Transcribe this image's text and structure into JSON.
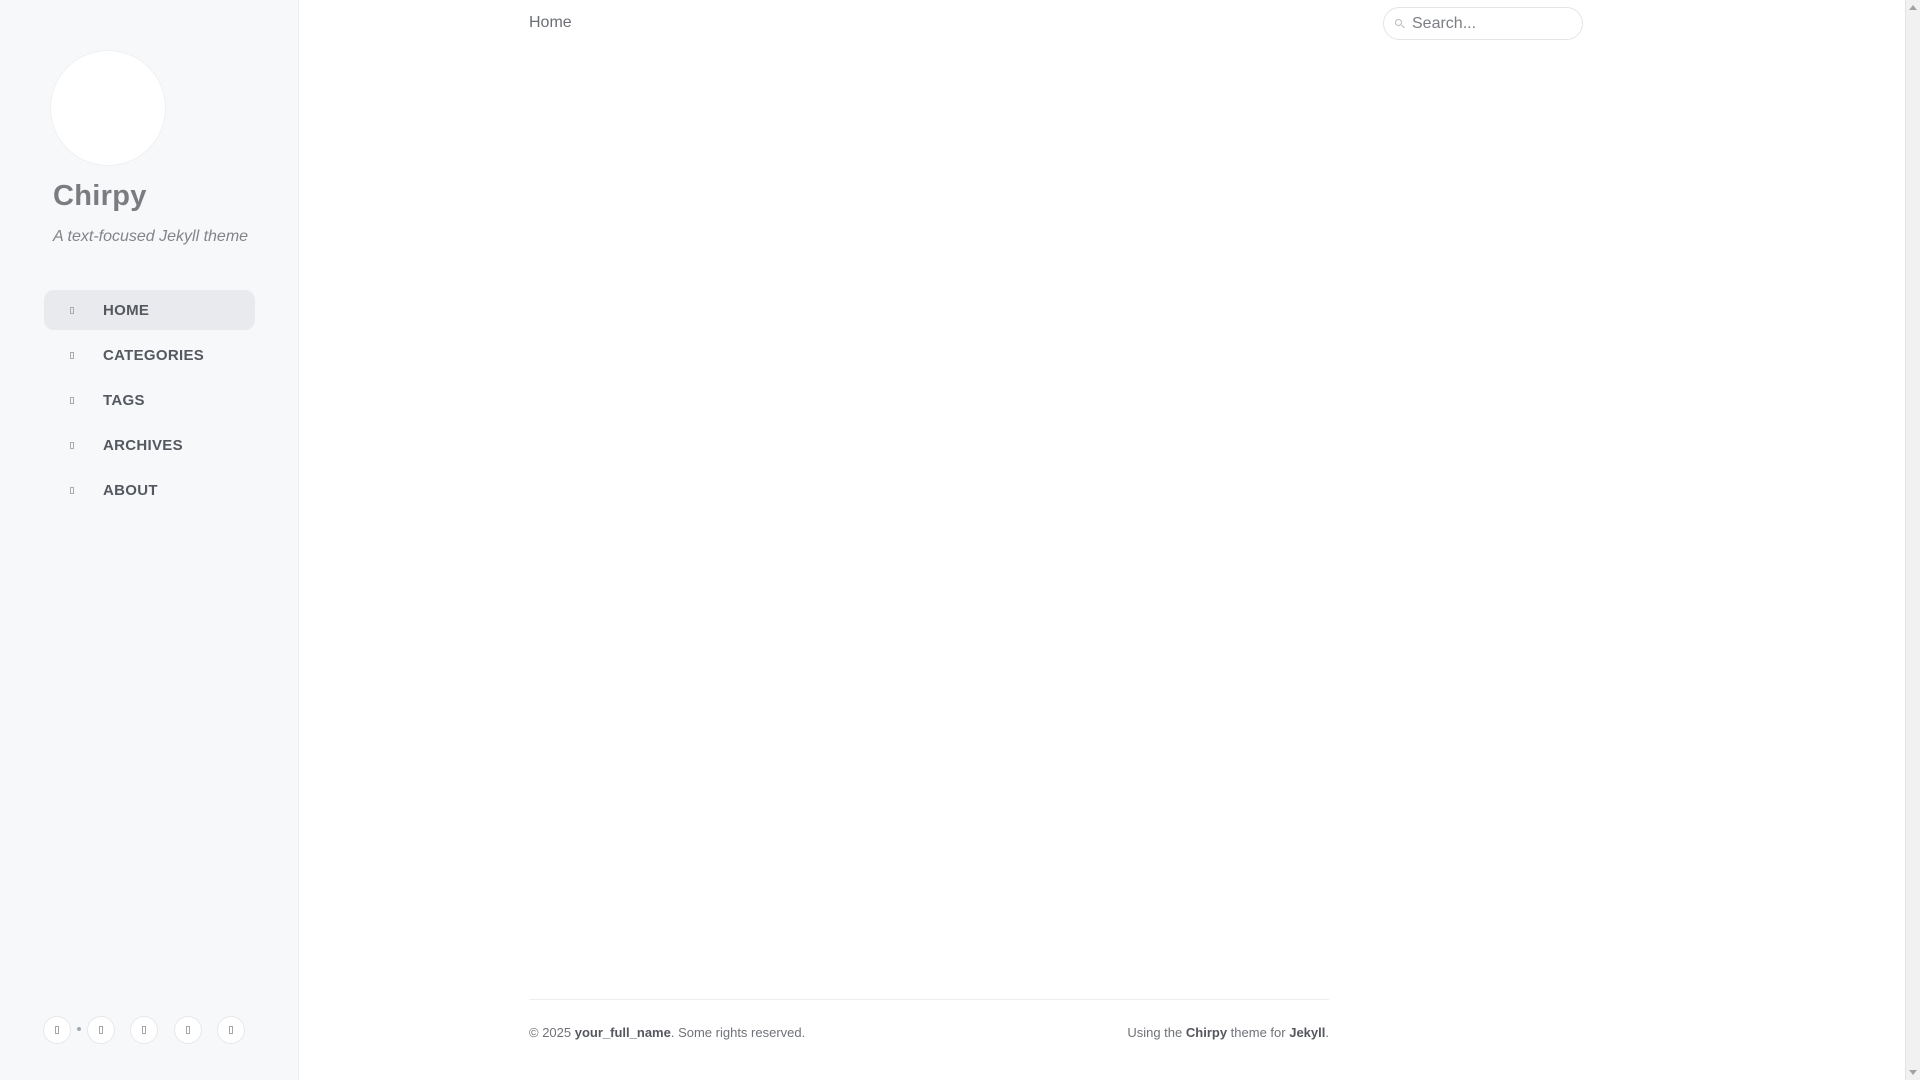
{
  "sidebar": {
    "title": "Chirpy",
    "subtitle": "A text-focused Jekyll theme",
    "nav": [
      {
        "label": "HOME",
        "icon": "home-icon",
        "active": true
      },
      {
        "label": "CATEGORIES",
        "icon": "stream-icon",
        "active": false
      },
      {
        "label": "TAGS",
        "icon": "tag-icon",
        "active": false
      },
      {
        "label": "ARCHIVES",
        "icon": "archive-icon",
        "active": false
      },
      {
        "label": "ABOUT",
        "icon": "info-icon",
        "active": false
      }
    ],
    "social": [
      "theme-toggle-icon",
      "github-icon",
      "twitter-icon",
      "email-icon",
      "rss-icon"
    ]
  },
  "topbar": {
    "breadcrumb": "Home",
    "search_placeholder": "Search..."
  },
  "footer": {
    "copyright_prefix": "© 2025",
    "author": "your_full_name",
    "rights": ". Some rights reserved.",
    "using_prefix": "Using the",
    "theme_name": "Chirpy",
    "theme_for": "theme for",
    "jekyll": "Jekyll",
    "period": "."
  },
  "colors": {
    "sidebar_bg": "#f6f8fa",
    "active_nav_bg": "#e8eaee",
    "text": "#34343c"
  }
}
